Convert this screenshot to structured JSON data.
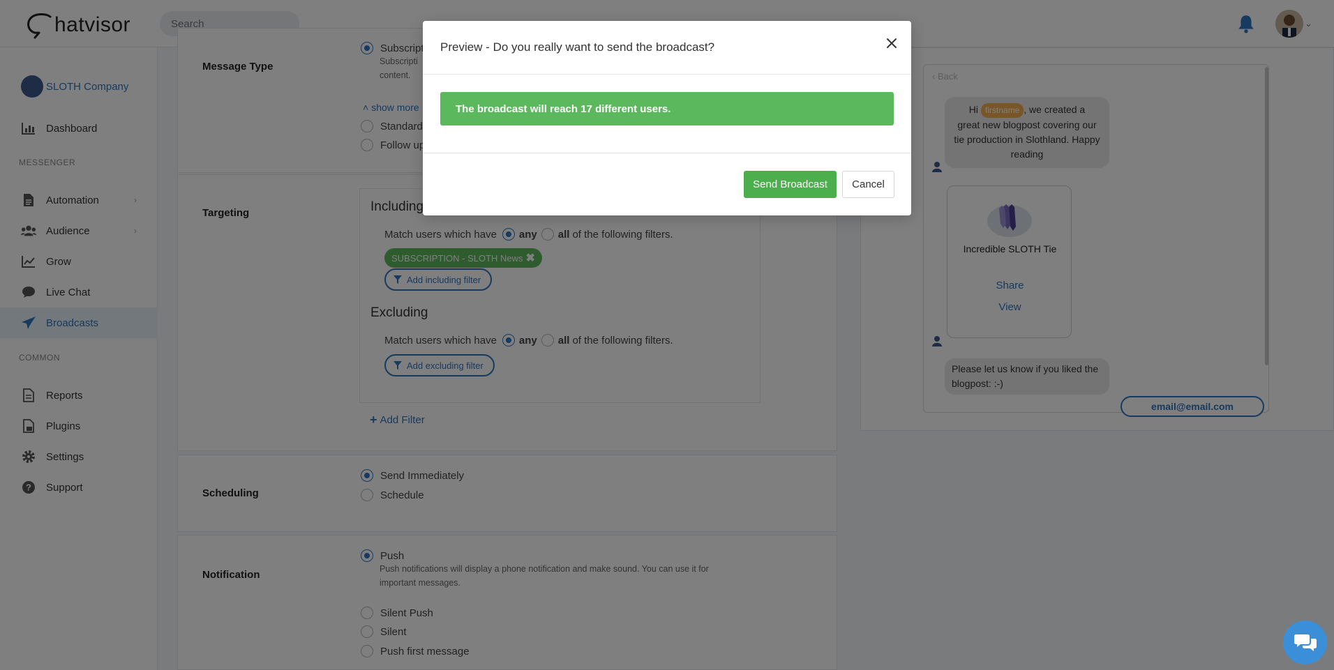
{
  "app": {
    "logo_text": "hatvisor",
    "search_placeholder": "Search"
  },
  "sidebar": {
    "company": "SLOTH Company",
    "items": [
      {
        "label": "Dashboard",
        "icon": "bar-chart-icon"
      },
      {
        "label": "Automation",
        "icon": "document-icon"
      },
      {
        "label": "Audience",
        "icon": "users-icon"
      },
      {
        "label": "Grow",
        "icon": "line-chart-icon"
      },
      {
        "label": "Live Chat",
        "icon": "chat-bubble-icon"
      },
      {
        "label": "Broadcasts",
        "icon": "paper-plane-icon"
      },
      {
        "label": "Reports",
        "icon": "file-icon"
      },
      {
        "label": "Plugins",
        "icon": "js-file-icon"
      },
      {
        "label": "Settings",
        "icon": "gear-icon"
      },
      {
        "label": "Support",
        "icon": "question-circle-icon"
      }
    ],
    "sections": {
      "messenger": "MESSENGER",
      "common": "COMMON"
    }
  },
  "message_type": {
    "label": "Message Type",
    "options": [
      "Subscriptio",
      "Subscripti",
      "content.",
      "Standard",
      "Follow up"
    ],
    "show_more": "show more"
  },
  "targeting": {
    "label": "Targeting",
    "including_title": "Including",
    "excluding_title": "Excluding",
    "match_prefix": "Match users which have",
    "any": "any",
    "all": "all",
    "match_suffix": "of the following filters.",
    "filter_tag": "SUBSCRIPTION - SLOTH News",
    "add_including": "Add including filter",
    "add_excluding": "Add excluding filter",
    "add_filter": "Add Filter"
  },
  "scheduling": {
    "label": "Scheduling",
    "send_immediately": "Send Immediately",
    "schedule": "Schedule"
  },
  "notification": {
    "label": "Notification",
    "push": "Push",
    "push_desc_1": "Push notifications will display a phone notification and make sound. You can use it for",
    "push_desc_2": "important messages.",
    "silent_push": "Silent Push",
    "silent": "Silent",
    "push_first": "Push first message"
  },
  "preview": {
    "back": "Back",
    "msg1_pre": "Hi",
    "firstname_chip": "firstname",
    "msg1_post_l1": ", we created a",
    "msg1_l2": "great new blogpost covering our",
    "msg1_l3": "tie production in Slothland. Happy",
    "msg1_l4": "reading",
    "product_title": "Incredible SLOTH Tie",
    "share": "Share",
    "view": "View",
    "msg2_l1": "Please let us know if you liked the",
    "msg2_l2": "blogpost: :-)",
    "email_button": "email@email.com"
  },
  "modal": {
    "title": "Preview - Do you really want to send the broadcast?",
    "alert": "The broadcast will reach 17 different users.",
    "send_button": "Send Broadcast",
    "cancel_button": "Cancel"
  },
  "colors": {
    "primary": "#2f74c0",
    "success": "#5cb85c",
    "tag_orange": "#f0ad4e"
  }
}
